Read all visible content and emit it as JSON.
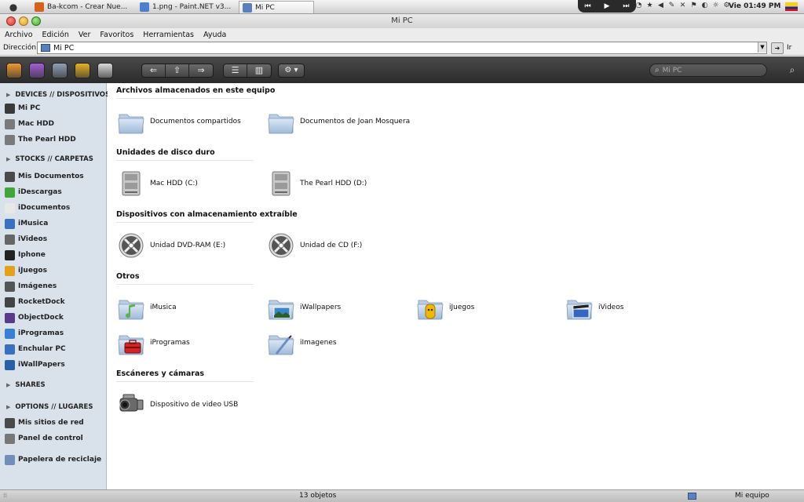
{
  "taskbar": {
    "tabs": [
      {
        "label": "Ba-kcom - Crear Nue...",
        "active": false,
        "icon": "firefox-icon",
        "color": "#d9601a"
      },
      {
        "label": "1.png - Paint.NET v3....",
        "active": false,
        "icon": "paintnet-icon",
        "color": "#4d7fd1"
      },
      {
        "label": "Mi PC",
        "active": true,
        "icon": "computer-icon",
        "color": "#5a7fbf"
      }
    ],
    "media": [
      "⏮",
      "▶",
      "⏭"
    ],
    "tray": [
      "◔",
      "★",
      "◀",
      "✎",
      "✕",
      "⚑",
      "◐",
      "☼",
      "⚙"
    ],
    "clock": "Vie 01:49 PM"
  },
  "window": {
    "title": "Mi PC"
  },
  "menu": [
    "Archivo",
    "Edición",
    "Ver",
    "Favoritos",
    "Herramientas",
    "Ayuda"
  ],
  "address": {
    "label": "Dirección",
    "value": "Mi PC",
    "go_label": "Ir"
  },
  "toolbar": {
    "apps": [
      "#f29a2e",
      "#a25ed6",
      "#8fa0b8",
      "#e6b324",
      "#d9d9d9"
    ],
    "nav": [
      "⇐",
      "⇧",
      "⇒"
    ],
    "views": [
      "☰",
      "▥"
    ],
    "action": "⚙ ▾",
    "search_placeholder": "Mi PC"
  },
  "sidebar": {
    "sections": [
      {
        "title": "DEVICES // DISPOSITIVOS",
        "items": [
          {
            "label": "Mi PC",
            "icon": "computer-icon",
            "color": "#3a3a3a"
          },
          {
            "label": "Mac HDD",
            "icon": "hdd-icon",
            "color": "#7a7a7a"
          },
          {
            "label": "The Pearl HDD",
            "icon": "hdd-icon",
            "color": "#7a7a7a"
          }
        ]
      },
      {
        "title": "STOCKS // CARPETAS",
        "items": [
          {
            "label": "Mis Documentos",
            "icon": "users-icon",
            "color": "#4a4a4a"
          },
          {
            "label": "iDescargas",
            "icon": "download-icon",
            "color": "#3fa63a"
          },
          {
            "label": "iDocumentos",
            "icon": "document-icon",
            "color": "#e8e8e8"
          },
          {
            "label": "iMusica",
            "icon": "music-note-icon",
            "color": "#3b6fc2"
          },
          {
            "label": "iVideos",
            "icon": "film-icon",
            "color": "#666666"
          },
          {
            "label": "Iphone",
            "icon": "phone-icon",
            "color": "#222222"
          },
          {
            "label": "iJuegos",
            "icon": "game-icon",
            "color": "#e3a21a"
          },
          {
            "label": "Imágenes",
            "icon": "camera-icon",
            "color": "#555555"
          },
          {
            "label": "RocketDock",
            "icon": "dock-icon",
            "color": "#444444"
          },
          {
            "label": "ObjectDock",
            "icon": "dock-icon",
            "color": "#5a3a8a"
          },
          {
            "label": "iProgramas",
            "icon": "app-store-icon",
            "color": "#3a7fd6"
          },
          {
            "label": "Enchular PC",
            "icon": "monitor-icon",
            "color": "#3a6fc0"
          },
          {
            "label": "iWallPapers",
            "icon": "monitor-icon",
            "color": "#2a5fa8"
          }
        ]
      },
      {
        "title": "SHARES",
        "items": []
      },
      {
        "title": "OPTIONS // LUGARES",
        "items": [
          {
            "label": "Mis sitios de red",
            "icon": "network-icon",
            "color": "#4a4a4a"
          },
          {
            "label": "Panel de control",
            "icon": "control-panel-icon",
            "color": "#777777"
          }
        ]
      },
      {
        "title": "",
        "items": [
          {
            "label": "Papelera de reciclaje",
            "icon": "trash-icon",
            "color": "#6f8fb8"
          }
        ]
      }
    ]
  },
  "main": {
    "sections": [
      {
        "title": "Archivos almacenados en este equipo",
        "items": [
          {
            "label": "Documentos compartidos",
            "icon": "folder-icon"
          },
          {
            "label": "Documentos de Joan Mosquera",
            "icon": "folder-icon"
          }
        ]
      },
      {
        "title": "Unidades de disco duro",
        "items": [
          {
            "label": "Mac HDD (C:)",
            "icon": "hard-drive-icon"
          },
          {
            "label": "The Pearl HDD (D:)",
            "icon": "hard-drive-icon"
          }
        ]
      },
      {
        "title": "Dispositivos con almacenamiento extraíble",
        "items": [
          {
            "label": "Unidad DVD-RAM (E:)",
            "icon": "optical-disc-icon"
          },
          {
            "label": "Unidad de CD (F:)",
            "icon": "optical-disc-icon"
          }
        ]
      },
      {
        "title": "Otros",
        "items": [
          {
            "label": "iMusica",
            "icon": "music-folder-icon",
            "color": "#58b34a"
          },
          {
            "label": "iWallpapers",
            "icon": "picture-folder-icon",
            "color": "#3a86c8"
          },
          {
            "label": "iJuegos",
            "icon": "games-folder-icon",
            "color": "#f2b800"
          },
          {
            "label": "iVideos",
            "icon": "video-folder-icon",
            "color": "#3566c0"
          },
          {
            "label": "iProgramas",
            "icon": "apps-folder-icon",
            "color": "#d22424"
          },
          {
            "label": "iImagenes",
            "icon": "images-folder-icon",
            "color": "#6d8fbf"
          }
        ]
      },
      {
        "title": "Escáneres y cámaras",
        "items": [
          {
            "label": "Dispositivo de video USB",
            "icon": "camcorder-icon"
          }
        ]
      }
    ]
  },
  "status": {
    "count": "13 objetos",
    "location": "Mi equipo"
  }
}
